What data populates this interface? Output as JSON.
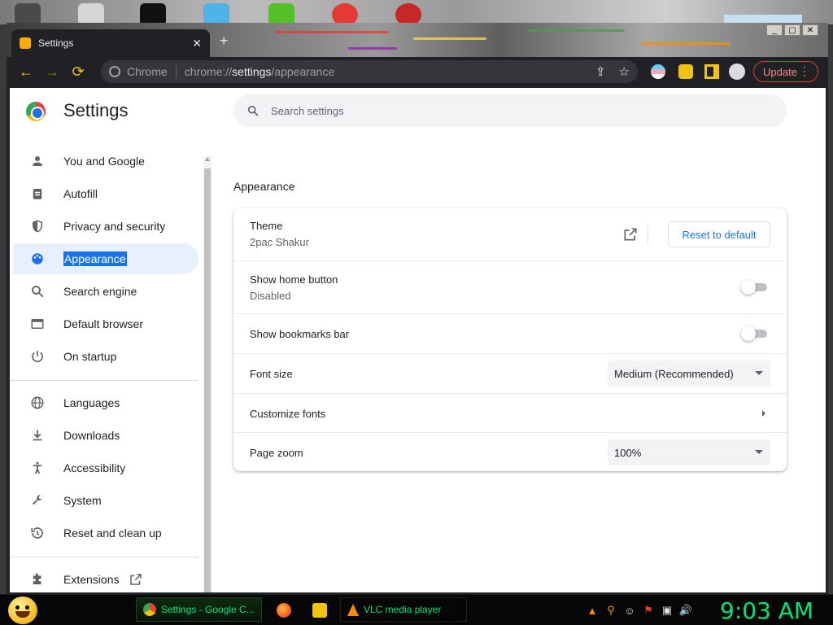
{
  "tab": {
    "title": "Settings",
    "close": "✕",
    "new": "+"
  },
  "window_controls": {
    "minimize": "_",
    "maximize": "▢",
    "close": "✕"
  },
  "toolbar": {
    "back": "←",
    "forward": "→",
    "reload": "⟳",
    "site_chip": "Chrome",
    "url_scheme": "chrome://",
    "url_host": "settings",
    "url_path": "/appearance",
    "share": "⇪",
    "bookmark": "☆",
    "update_label": "Update",
    "menu": "⋮"
  },
  "settings": {
    "app_title": "Settings",
    "search_placeholder": "Search settings"
  },
  "sidebar": {
    "items": [
      {
        "label": "You and Google",
        "icon": "person-icon",
        "glyph": "👤"
      },
      {
        "label": "Autofill",
        "icon": "clipboard-icon",
        "glyph": "📋"
      },
      {
        "label": "Privacy and security",
        "icon": "shield-icon",
        "glyph": "🛡"
      },
      {
        "label": "Appearance",
        "icon": "palette-icon",
        "glyph": "🎨"
      },
      {
        "label": "Search engine",
        "icon": "search-icon",
        "glyph": "🔍"
      },
      {
        "label": "Default browser",
        "icon": "browser-icon",
        "glyph": "▭"
      },
      {
        "label": "On startup",
        "icon": "power-icon",
        "glyph": "⏻"
      },
      {
        "label": "Languages",
        "icon": "globe-icon",
        "glyph": "🌐"
      },
      {
        "label": "Downloads",
        "icon": "download-icon",
        "glyph": "⤓"
      },
      {
        "label": "Accessibility",
        "icon": "accessibility-icon",
        "glyph": "♿"
      },
      {
        "label": "System",
        "icon": "wrench-icon",
        "glyph": "🔧"
      },
      {
        "label": "Reset and clean up",
        "icon": "history-icon",
        "glyph": "↺"
      },
      {
        "label": "Extensions",
        "icon": "puzzle-icon",
        "glyph": "🧩"
      }
    ],
    "active": "Appearance"
  },
  "appearance": {
    "section_title": "Appearance",
    "theme": {
      "label": "Theme",
      "value": "2pac Shakur",
      "reset_label": "Reset to default"
    },
    "home_button": {
      "label": "Show home button",
      "value": "Disabled",
      "enabled": false
    },
    "bookmarks_bar": {
      "label": "Show bookmarks bar",
      "enabled": false
    },
    "font_size": {
      "label": "Font size",
      "value": "Medium (Recommended)"
    },
    "customize_fonts": {
      "label": "Customize fonts"
    },
    "page_zoom": {
      "label": "Page zoom",
      "value": "100%"
    }
  },
  "taskbar": {
    "tasks": [
      {
        "label": "Settings - Google C..."
      },
      {
        "label": "VLC media player"
      }
    ],
    "clock": "9:03 AM"
  },
  "colors": {
    "accent": "#1a73e8",
    "active_nav_bg": "#e8f0fe",
    "update_red": "#e53935",
    "clock_green": "#00e676"
  }
}
